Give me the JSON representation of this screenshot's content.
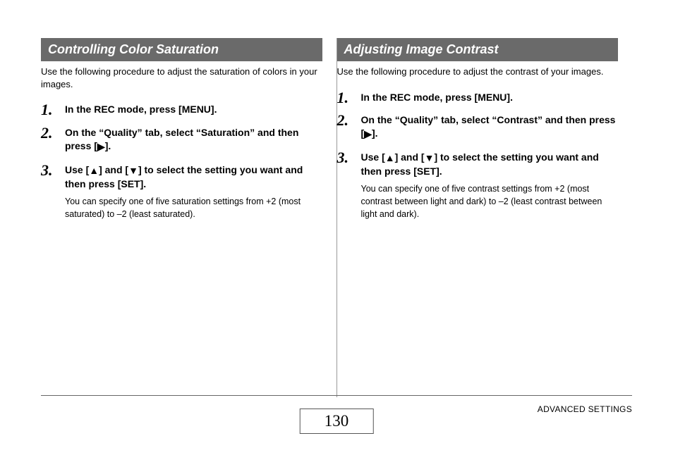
{
  "footer": {
    "page_number": "130",
    "section_label": "ADVANCED SETTINGS"
  },
  "icons": {
    "right": "▶",
    "up": "▲",
    "down": "▼"
  },
  "left": {
    "heading": "Controlling Color Saturation",
    "intro": "Use the following procedure to adjust the saturation of colors in your images.",
    "steps": [
      {
        "head": "In the REC mode, press [MENU]."
      },
      {
        "head_before": "On the “Quality” tab, select “Saturation” and then press [",
        "head_after": "]."
      },
      {
        "head_before": "Use [",
        "head_mid": "] and [",
        "head_after": "] to select the setting you want and then press [SET].",
        "note": "You can specify one of five saturation settings from +2 (most saturated) to –2 (least saturated)."
      }
    ]
  },
  "right": {
    "heading": "Adjusting Image Contrast",
    "intro": "Use the following procedure to adjust the contrast of your images.",
    "steps": [
      {
        "head": "In the REC mode, press [MENU]."
      },
      {
        "head_before": "On the “Quality” tab, select “Contrast” and then press [",
        "head_after": "]."
      },
      {
        "head_before": "Use [",
        "head_mid": "] and [",
        "head_after": "] to select the setting you want and then press [SET].",
        "note": "You can specify one of five contrast settings from +2 (most contrast between light and dark) to –2 (least contrast between light and dark)."
      }
    ]
  }
}
